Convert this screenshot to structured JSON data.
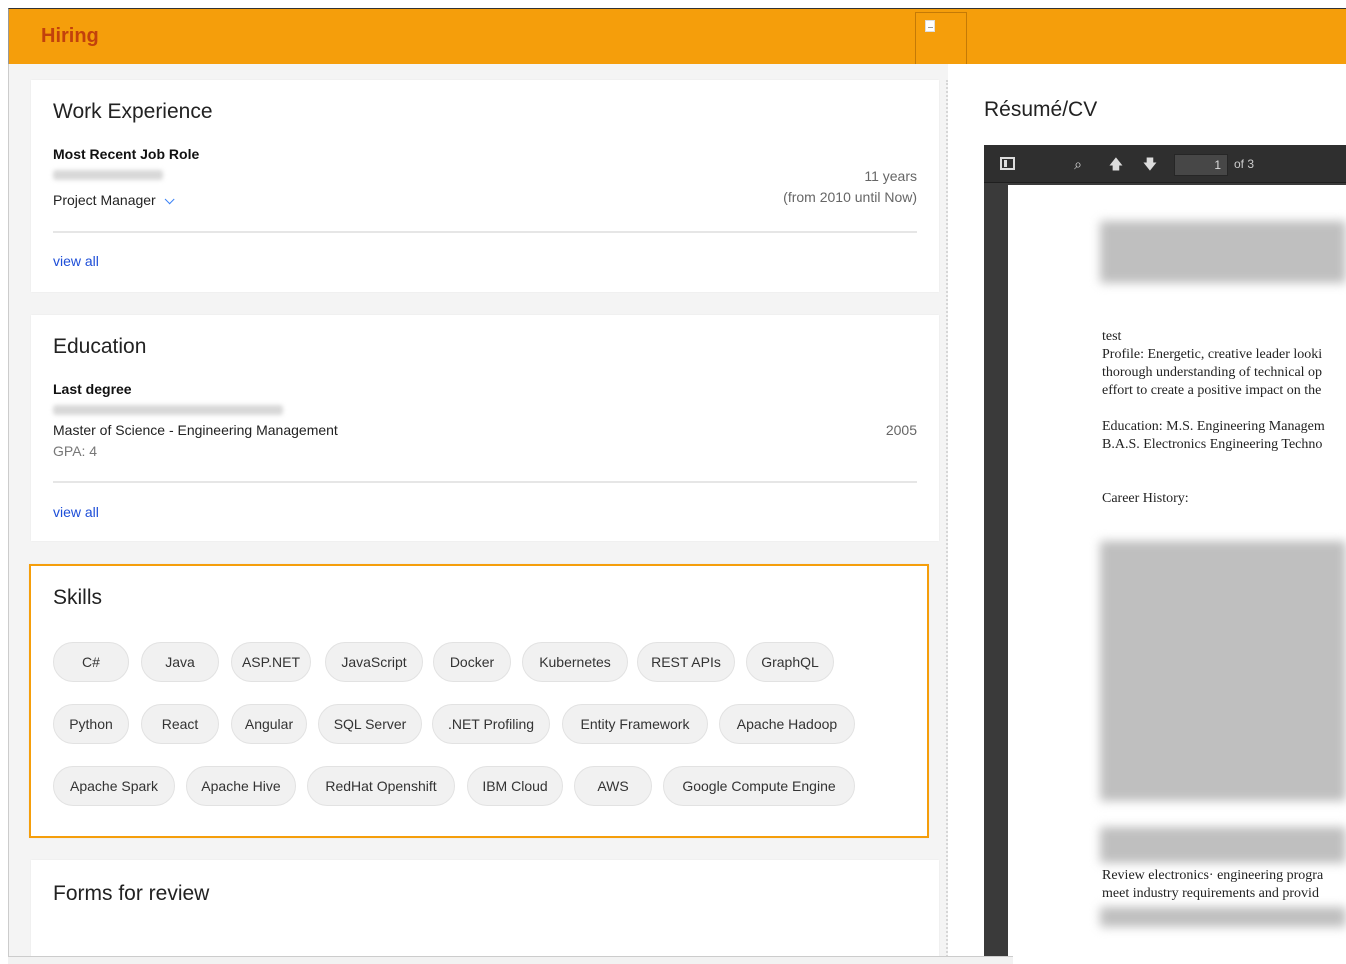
{
  "header": {
    "title": "Hiring"
  },
  "work_experience": {
    "title": "Work Experience",
    "section_label": "Most Recent Job Role",
    "role": "Project Manager",
    "duration": "11 years",
    "period": "(from 2010 until Now)",
    "view_all": "view all"
  },
  "education": {
    "title": "Education",
    "section_label": "Last degree",
    "degree": "Master of Science - Engineering Management",
    "gpa": "GPA: 4",
    "year": "2005",
    "view_all": "view all"
  },
  "skills": {
    "title": "Skills",
    "items": [
      "C#",
      "Java",
      "ASP.NET",
      "JavaScript",
      "Docker",
      "Kubernetes",
      "REST APIs",
      "GraphQL",
      "Python",
      "React",
      "Angular",
      "SQL Server",
      ".NET Profiling",
      "Entity Framework",
      "Apache Hadoop",
      "Apache Spark",
      "Apache Hive",
      "RedHat Openshift",
      "IBM Cloud",
      "AWS",
      "Google Compute Engine"
    ]
  },
  "forms": {
    "title": "Forms for review"
  },
  "resume": {
    "title": "Résumé/CV",
    "page_current": "1",
    "page_total": "of 3",
    "lines": {
      "test": "test",
      "profile_1": "Profile: Energetic, creative leader looki",
      "profile_2": "thorough understanding of technical op",
      "profile_3": "effort to create a positive impact on the",
      "edu_1": "Education: M.S. Engineering Managem",
      "edu_2": "B.A.S. Electronics Engineering Techno",
      "career": "Career History:",
      "review_1": "Review electronics· engineering progra",
      "review_2": "meet industry requirements and provid"
    }
  },
  "icons": {
    "sidebar": "sidebar-toggle-icon",
    "search": "search-icon",
    "prev": "arrow-up-icon",
    "next": "arrow-down-icon",
    "header_tab": "document-icon"
  },
  "colors": {
    "accent": "#f59e0b",
    "title_text": "#c2410c",
    "link": "#1d4ed8"
  }
}
